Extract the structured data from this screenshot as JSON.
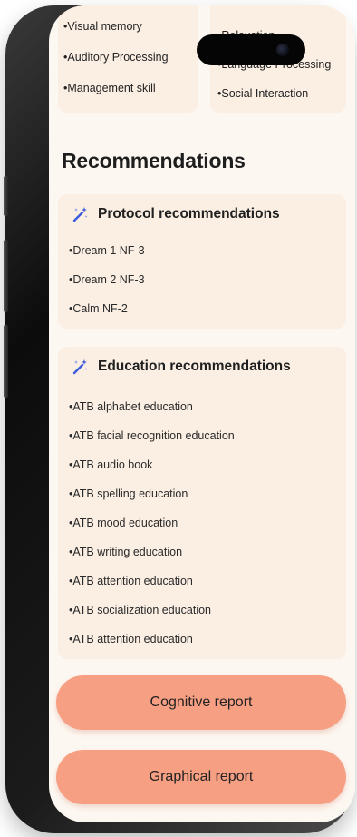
{
  "skills_left": [
    "•Visual memory",
    "•Auditory Processing",
    "•Management skill"
  ],
  "skills_right": [
    "•Relaxation",
    "•Language Processing",
    "•Social Interaction"
  ],
  "recommendations": {
    "title": "Recommendations",
    "protocol": {
      "title": "Protocol recommendations",
      "icon": "magic-wand-icon",
      "items": [
        "•Dream 1 NF-3",
        "•Dream 2 NF-3",
        "•Calm NF-2"
      ]
    },
    "education": {
      "title": "Education recommendations",
      "icon": "magic-wand-icon",
      "items": [
        "•ATB alphabet education",
        "•ATB facial recognition education",
        "•ATB audio book",
        "•ATB spelling education",
        "•ATB mood education",
        "•ATB writing education",
        "•ATB attention education",
        "•ATB socialization education",
        "•ATB attention education"
      ]
    }
  },
  "buttons": {
    "cognitive_report": "Cognitive report",
    "graphical_report": "Graphical report"
  },
  "colors": {
    "screen_bg": "#fdf7f1",
    "card_bg": "#fbefe4",
    "button_bg": "#f79f82",
    "icon_blue": "#3b5bdb"
  }
}
